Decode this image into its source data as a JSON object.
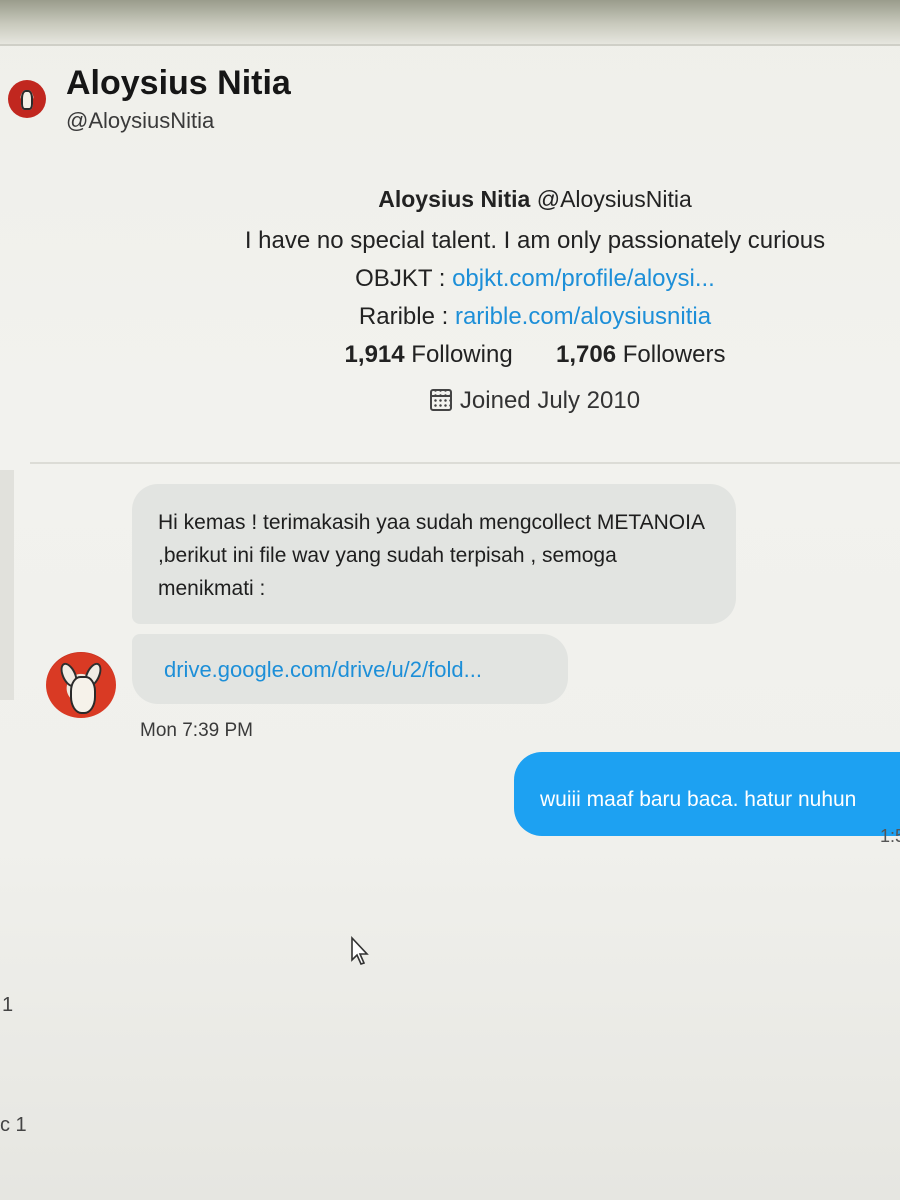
{
  "header": {
    "name": "Aloysius Nitia",
    "handle": "@AloysiusNitia"
  },
  "profile": {
    "name": "Aloysius Nitia",
    "handle": "@AloysiusNitia",
    "bio": "I have no special talent. I am only passionately curious",
    "objkt_label": "OBJKT :",
    "objkt_link": "objkt.com/profile/aloysi...",
    "rarible_label": "Rarible :",
    "rarible_link": "rarible.com/aloysiusnitia",
    "following_count": "1,914",
    "following_label": "Following",
    "followers_count": "1,706",
    "followers_label": "Followers",
    "joined": "Joined July 2010"
  },
  "messages": {
    "incoming_text": "Hi kemas ! terimakasih yaa sudah mengcollect METANOIA ,berikut ini file wav yang sudah terpisah , semoga menikmati :",
    "incoming_link": "drive.google.com/drive/u/2/fold...",
    "incoming_time": "Mon 7:39 PM",
    "outgoing_text": "wuiii maaf baru baca. hatur nuhun",
    "outgoing_time": "1:5"
  },
  "edge": {
    "num1": "1",
    "num2": "c 1"
  },
  "icons": [
    "calendar-icon",
    "cursor-icon",
    "avatar"
  ],
  "colors": {
    "link": "#1d8fd8",
    "outgoing_bubble": "#1da1f2",
    "incoming_bubble": "#e2e4e1"
  }
}
